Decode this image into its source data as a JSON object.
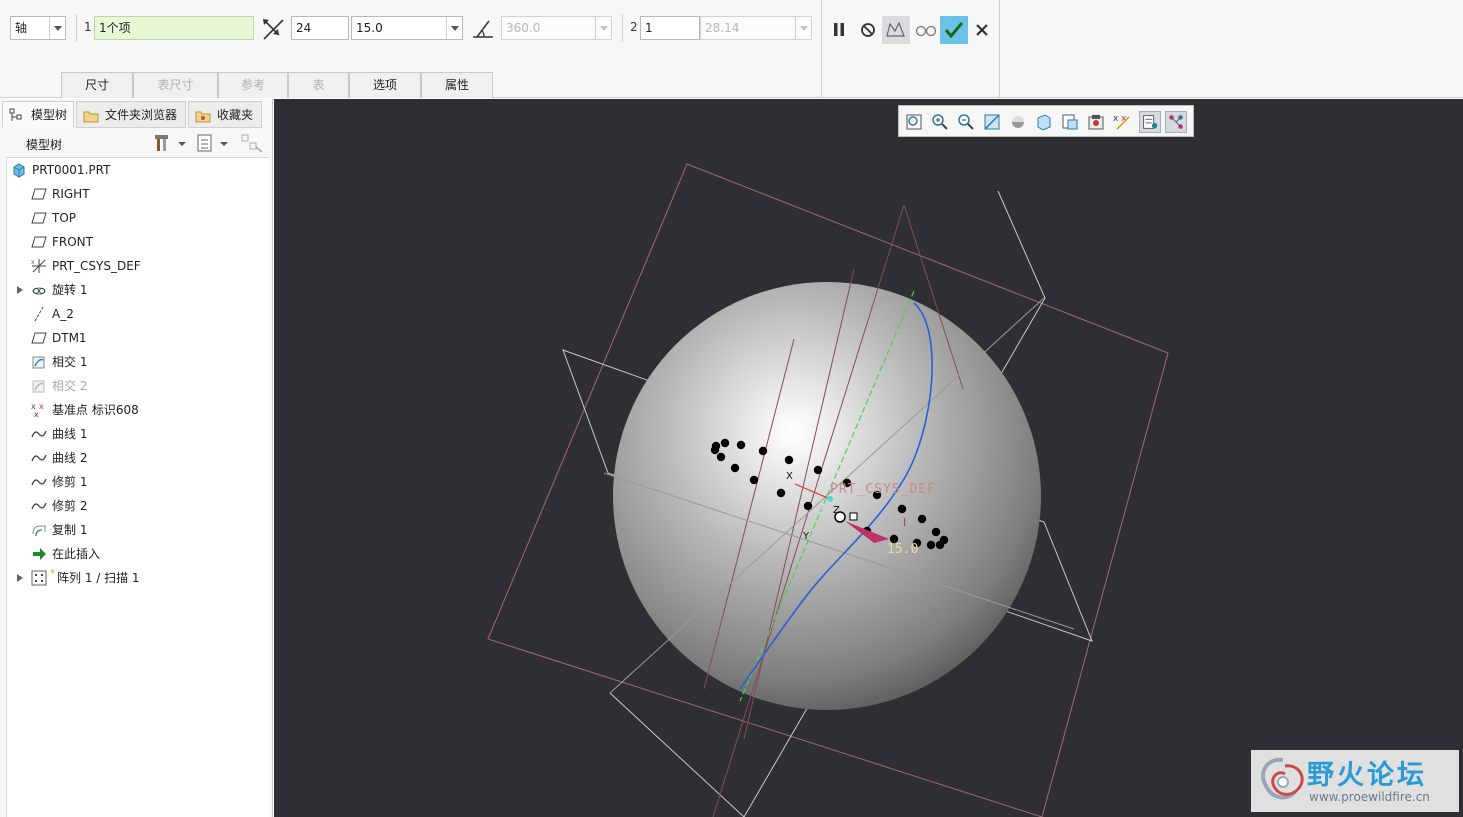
{
  "dashboard": {
    "axis_type": "轴",
    "ref_index": "1",
    "ref_value": "1个项",
    "count": "24",
    "increment": "15.0",
    "angle_total": "360.0",
    "dir2_index": "2",
    "dir2_count": "1",
    "dir2_spacing": "28.14",
    "tabs": [
      "尺寸",
      "表尺寸",
      "参考",
      "表",
      "选项",
      "属性"
    ]
  },
  "panel": {
    "tabs": [
      "模型树",
      "文件夹浏览器",
      "收藏夹"
    ],
    "header": "模型树",
    "items": [
      {
        "label": "PRT0001.PRT",
        "icon": "part-icon"
      },
      {
        "label": "RIGHT",
        "icon": "datum-plane-icon"
      },
      {
        "label": "TOP",
        "icon": "datum-plane-icon"
      },
      {
        "label": "FRONT",
        "icon": "datum-plane-icon"
      },
      {
        "label": "PRT_CSYS_DEF",
        "icon": "csys-icon"
      },
      {
        "label": "旋转 1",
        "icon": "revolve-icon"
      },
      {
        "label": "A_2",
        "icon": "axis-icon"
      },
      {
        "label": "DTM1",
        "icon": "datum-plane-icon"
      },
      {
        "label": "相交 1",
        "icon": "intersect-icon"
      },
      {
        "label": "相交 2",
        "icon": "intersect-icon"
      },
      {
        "label": "基准点 标识608",
        "icon": "datum-point-icon"
      },
      {
        "label": "曲线 1",
        "icon": "curve-icon"
      },
      {
        "label": "曲线 2",
        "icon": "curve-icon"
      },
      {
        "label": "修剪 1",
        "icon": "curve-icon"
      },
      {
        "label": "修剪 2",
        "icon": "curve-icon"
      },
      {
        "label": "复制 1",
        "icon": "copy-icon"
      },
      {
        "label": "在此插入",
        "icon": "insert-here-icon"
      },
      {
        "label": "阵列 1 / 扫描 1",
        "icon": "pattern-icon"
      }
    ]
  },
  "viewport": {
    "csys_label": "PRT_CSYS_DEF",
    "dim_value": "15.0",
    "axis_y": "Y",
    "axis_z": "Z",
    "axis_x": "X"
  },
  "watermark": {
    "title": "野火论坛",
    "url": "www.proewildfire.cn"
  }
}
